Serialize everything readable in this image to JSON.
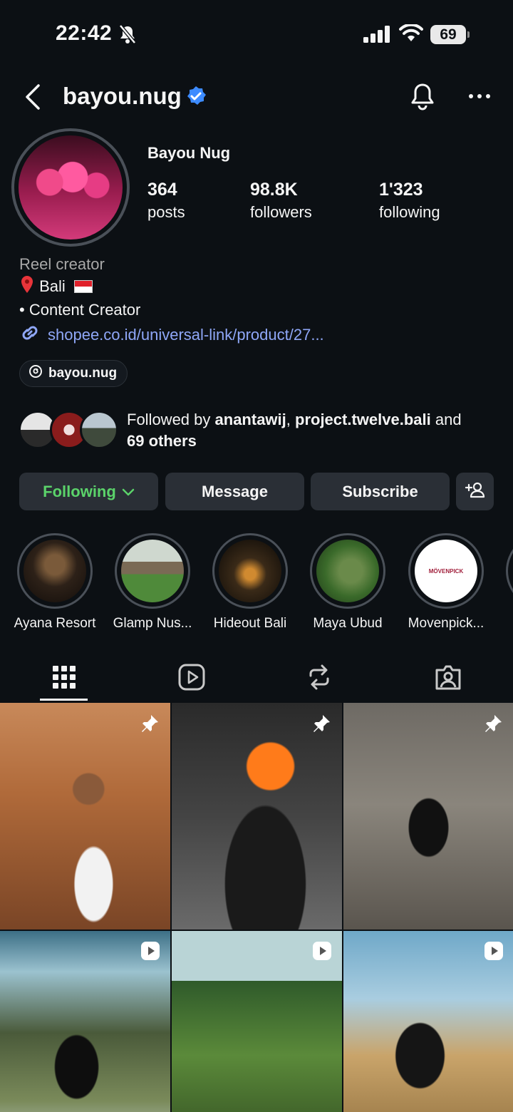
{
  "status_bar": {
    "time": "22:42",
    "battery": "69"
  },
  "header": {
    "username": "bayou.nug"
  },
  "profile": {
    "display_name": "Bayou Nug",
    "stats": {
      "posts": {
        "value": "364",
        "label": "posts"
      },
      "followers": {
        "value": "98.8K",
        "label": "followers"
      },
      "following": {
        "value": "1'323",
        "label": "following"
      }
    },
    "bio": {
      "category": "Reel creator",
      "location": "Bali",
      "line": "• Content Creator",
      "link": "shopee.co.id/universal-link/product/27..."
    },
    "threads_handle": "bayou.nug",
    "followed_by": {
      "prefix": "Followed by ",
      "user1": "anantawij",
      "sep": ", ",
      "user2": "project.twelve.bali",
      "and": " and",
      "others": "69 others"
    }
  },
  "actions": {
    "following": "Following",
    "message": "Message",
    "subscribe": "Subscribe"
  },
  "highlights": [
    {
      "label": "Ayana Resort"
    },
    {
      "label": "Glamp Nus..."
    },
    {
      "label": "Hideout Bali"
    },
    {
      "label": "Maya Ubud"
    },
    {
      "label": "Movenpick..."
    }
  ],
  "highlight_logo_text": "MÖVENPICK",
  "tabs": [
    "grid-icon",
    "reels-icon",
    "reposts-icon",
    "tagged-icon"
  ],
  "colors": {
    "background": "#0c1014",
    "following_green": "#5bd36a",
    "link_blue": "#8fa7f7",
    "verified_blue": "#3d8bff"
  }
}
